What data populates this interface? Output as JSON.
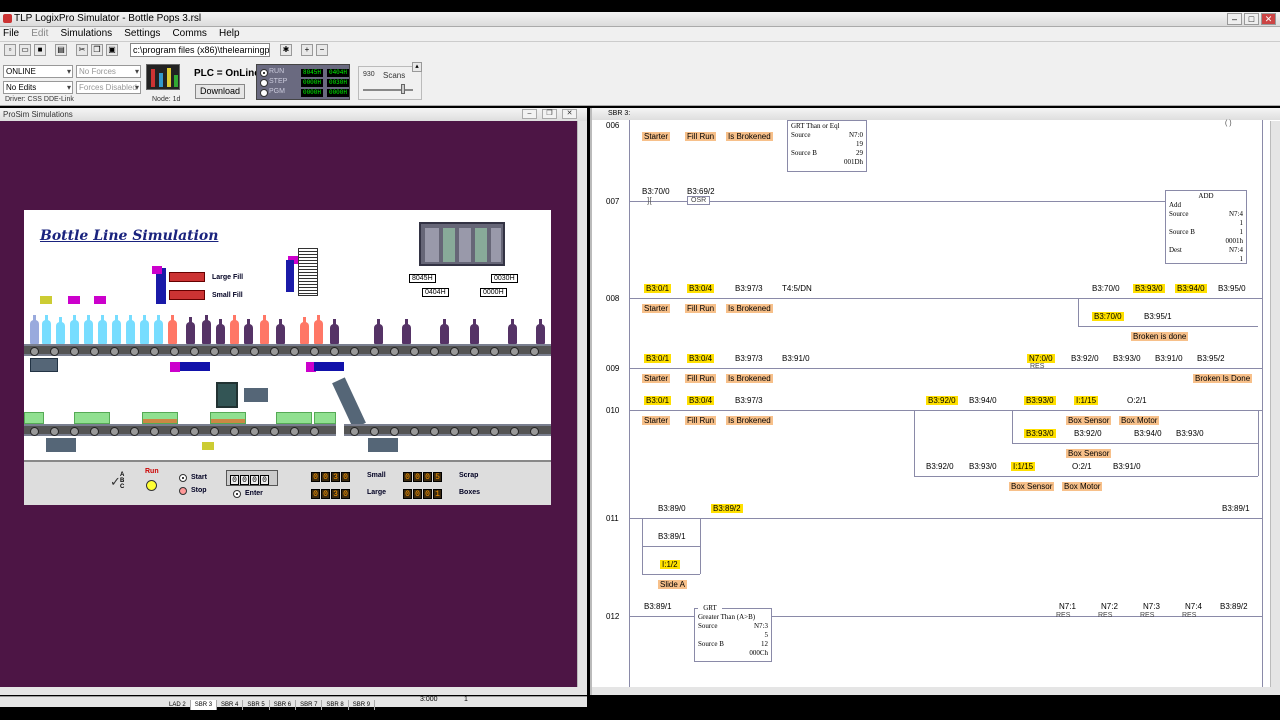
{
  "window_title": "TLP LogixPro Simulator  -  Bottle Pops 3.rsl",
  "menu": [
    "File",
    "Edit",
    "Simulations",
    "Settings",
    "Comms",
    "Help"
  ],
  "toolbar": {
    "path": "c:\\program files (x86)\\thelearningpit\\logixpr"
  },
  "status": {
    "mode": "ONLINE",
    "forces": "No Forces",
    "edits": "No Edits",
    "forces_disabled": "Forces Disabled",
    "driver": "Driver: CSS DDE-Link",
    "node": "Node: 1d",
    "plc_label": "PLC = OnLine",
    "download": "Download",
    "run": "RUN",
    "step": "STEP",
    "pgm": "PGM",
    "hex": [
      "8045H",
      "0404H",
      "0000H",
      "0030H",
      "0000H",
      "0000H"
    ],
    "scan_value": "930",
    "scans_label": "Scans"
  },
  "left_window": {
    "title": "ProSim Simulations"
  },
  "sim": {
    "title": "Bottle Line Simulation",
    "large_fill": "Large Fill",
    "small_fill": "Small Fill",
    "tags": [
      "8045H",
      "0030H",
      "0404H",
      "0000H"
    ],
    "run": "Run",
    "start": "Start",
    "stop": "Stop",
    "enter": "Enter",
    "small": "Small",
    "large": "Large",
    "scrap": "Scrap",
    "boxes": "Boxes",
    "small_count": [
      "0",
      "0",
      "3",
      "0"
    ],
    "large_count": [
      "0",
      "0",
      "3",
      "0"
    ],
    "scrap_count": [
      "0",
      "0",
      "0",
      "5"
    ],
    "boxes_count": [
      "0",
      "0",
      "0",
      "1"
    ],
    "thumbwheel": [
      "0",
      "0",
      "0",
      "0"
    ]
  },
  "tabs": [
    "LAD 2",
    "SBR 3",
    "SBR 4",
    "SBR 5",
    "SBR 6",
    "SBR 7",
    "SBR 8",
    "SBR 9"
  ],
  "coords": {
    "a": "3:000",
    "b": "1"
  },
  "ladder": {
    "title": "SBR 3:",
    "r006": {
      "num": "006",
      "d1": "Starter",
      "d2": "Fill Run",
      "d3": "Is Brokened",
      "blk_head": "GRT Than or Eql",
      "src": "Source",
      "srcv": "N7:0",
      "srcn": "19",
      "srcb": "Source B",
      "srcbv": "29",
      "srcbh": "001Dh"
    },
    "r007": {
      "num": "007",
      "t1": "B3:70/0",
      "t2": "B3:69/2",
      "osr": "OSR",
      "blk": "ADD",
      "add": "Add",
      "src": "Source",
      "srcv": "N7:4",
      "srcn": "1",
      "srcb": "Source B",
      "srcbv": "1",
      "srcbh": "0001h",
      "dest": "Dest",
      "destv": "N7:4",
      "destn": "1"
    },
    "r008": {
      "num": "008",
      "t1": "B3:0/1",
      "t2": "B3:0/4",
      "t3": "B3:97/3",
      "t4": "T4:5/DN",
      "t5": "B3:70/0",
      "t6": "B3:93/0",
      "t7": "B3:94/0",
      "t8": "B3:95/0",
      "t9": "B3:70/0",
      "t10": "B3:95/1",
      "d1": "Starter",
      "d2": "Fill Run",
      "d3": "Is Brokened",
      "d4": "Broken is done"
    },
    "r009": {
      "num": "009",
      "t1": "B3:0/1",
      "t2": "B3:0/4",
      "t3": "B3:97/3",
      "t4": "B3:91/0",
      "t5": "N7:0/0",
      "t6": "B3:92/0",
      "t7": "B3:93/0",
      "t8": "B3:91/0",
      "t9": "B3:95/2",
      "d1": "Starter",
      "d2": "Fill Run",
      "d3": "Is Brokened",
      "d4": "Broken Is Done",
      "res": "RES"
    },
    "r010": {
      "num": "010",
      "t1": "B3:0/1",
      "t2": "B3:0/4",
      "t3": "B3:97/3",
      "t4": "B3:92/0",
      "t5": "B3:94/0",
      "t6": "B3:93/0",
      "t7": "I:1/15",
      "t8": "O:2/1",
      "t9": "B3:93/0",
      "t10": "B3:92/0",
      "t11": "B3:94/0",
      "t12": "B3:93/0",
      "t13": "B3:92/0",
      "t14": "B3:93/0",
      "t15": "I:1/15",
      "t16": "O:2/1",
      "t17": "B3:91/0",
      "d1": "Starter",
      "d2": "Fill Run",
      "d3": "Is Brokened",
      "d4": "Box Sensor",
      "d5": "Box Motor",
      "d6": "Box Sensor",
      "d7": "Box Sensor",
      "d8": "Box Motor"
    },
    "r011": {
      "num": "011",
      "t1": "B3:89/0",
      "t2": "B3:89/2",
      "t3": "B3:89/1",
      "t4": "I:1/2",
      "t5": "B3:89/1",
      "d1": "Slide A"
    },
    "r012": {
      "num": "012",
      "t1": "B3:89/1",
      "blk": "GRT",
      "blk2": "Greater Than (A>B)",
      "src": "Source",
      "srcv": "N7:3",
      "srcn": "5",
      "srcb": "Source B",
      "srcbv": "12",
      "srcbh": "000Ch",
      "t2": "N7:1",
      "t3": "N7:2",
      "t4": "N7:3",
      "t5": "N7:4",
      "t6": "B3:89/2",
      "res": "RES"
    }
  }
}
